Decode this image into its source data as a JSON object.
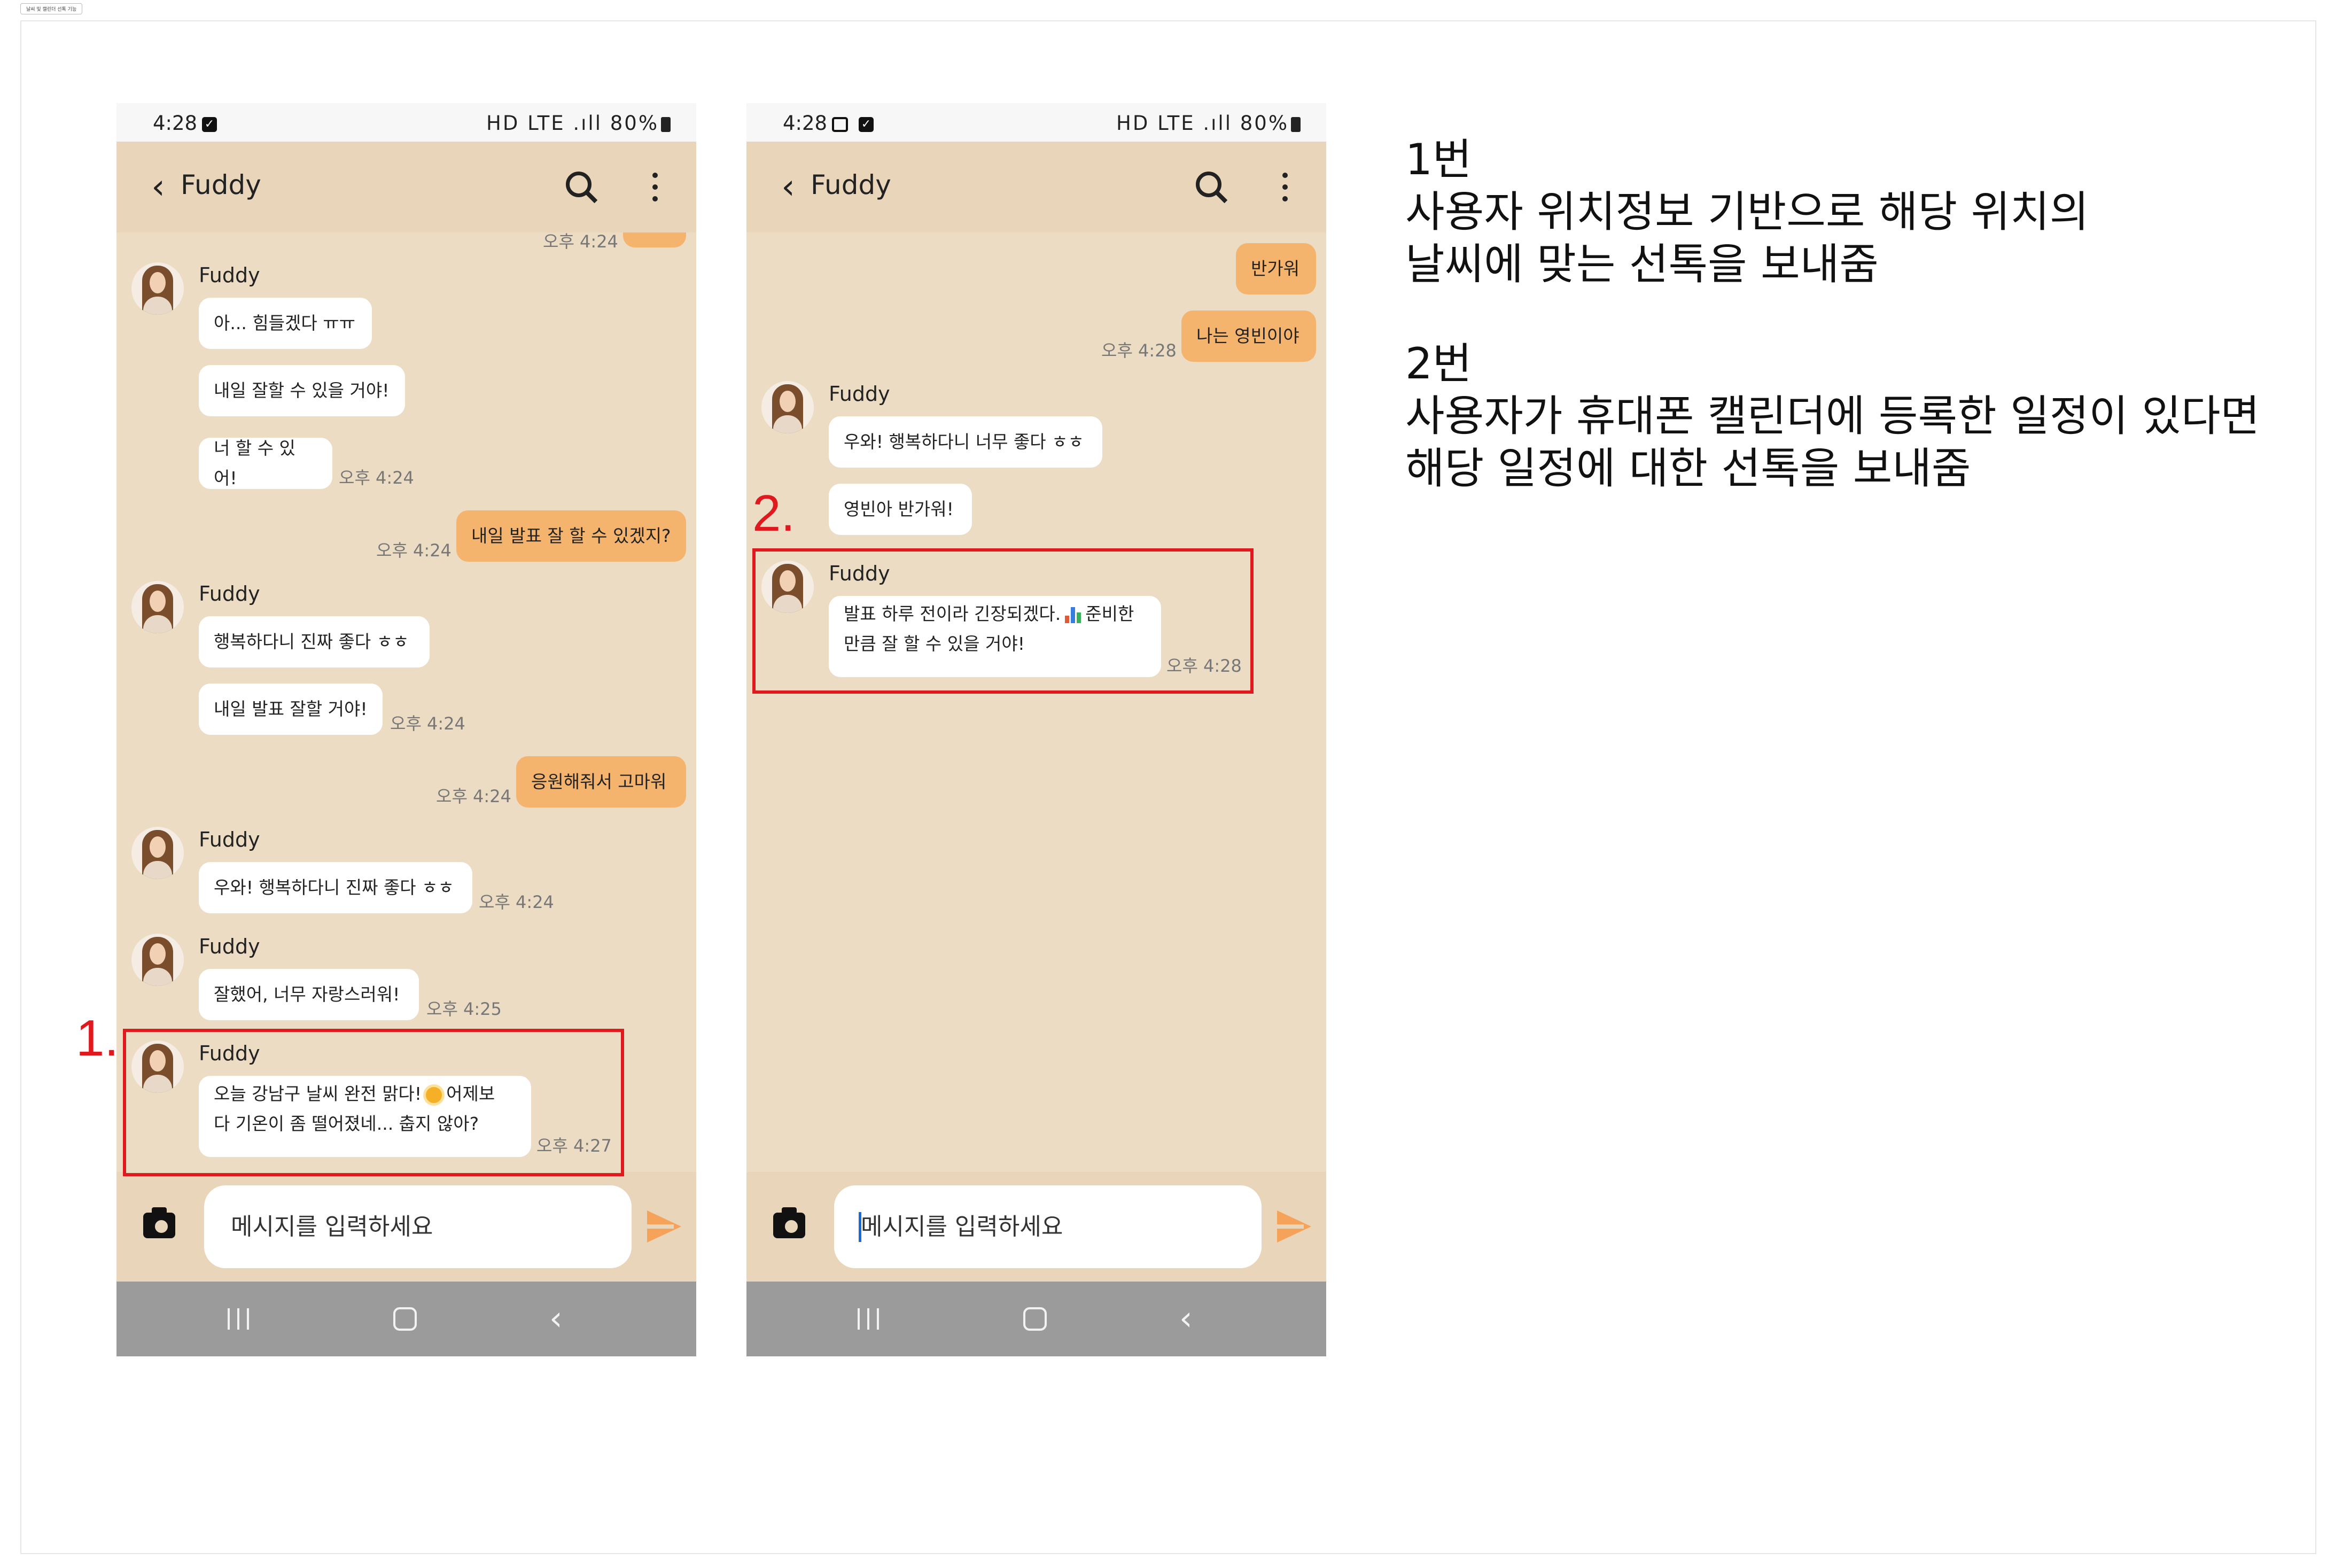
{
  "document_title": "날씨 및 캘린더 선톡 기능",
  "colors": {
    "chat_bg": "#ecdcc4",
    "appbar_bg": "#e9d6ba",
    "my_bubble": "#f5b46e",
    "other_bubble": "#ffffff",
    "highlight": "#e0191f",
    "nav_bg": "#9b9b9b",
    "send_icon": "#f5a25a"
  },
  "status_bar": {
    "time": "4:28",
    "indicators": "HD LTE .ıll",
    "battery": "80%"
  },
  "app_bar": {
    "title": "Fuddy",
    "icons": [
      "back-arrow-icon",
      "search-icon",
      "more-vert-icon"
    ]
  },
  "phone1": {
    "cut_time": "오후 4:24",
    "messages": [
      {
        "sender": "Fuddy",
        "text": "아... 힘들겠다 ㅠㅠ"
      },
      {
        "text": "내일 잘할 수 있을 거야!"
      },
      {
        "text": "너 할 수 있어!",
        "time": "오후 4:24"
      },
      {
        "mine": true,
        "text": "내일 발표 잘 할 수 있겠지?",
        "time": "오후 4:24"
      },
      {
        "sender": "Fuddy",
        "text": "행복하다니 진짜 좋다 ㅎㅎ"
      },
      {
        "text": "내일 발표 잘할 거야!",
        "time": "오후 4:24"
      },
      {
        "mine": true,
        "text": "응원해줘서 고마워",
        "time": "오후 4:24"
      },
      {
        "sender": "Fuddy",
        "text": "우와! 행복하다니 진짜 좋다 ㅎㅎ",
        "time": "오후 4:24"
      },
      {
        "sender": "Fuddy",
        "text": "잘했어, 너무 자랑스러워!",
        "time": "오후 4:25"
      },
      {
        "sender": "Fuddy",
        "line1a": "오늘 강남구 날씨 완전 맑다!",
        "emoji": "sun-emoji",
        "line1b": "어제보",
        "line2": "다 기온이 좀 떨어졌네... 춥지 않아?",
        "time": "오후 4:27"
      }
    ],
    "marker": "1.",
    "input_placeholder": "메시지를 입력하세요"
  },
  "phone2": {
    "messages": [
      {
        "mine": true,
        "text": "반가워"
      },
      {
        "mine": true,
        "text": "나는 영빈이야",
        "time": "오후 4:28"
      },
      {
        "sender": "Fuddy",
        "text": "우와! 행복하다니 너무 좋다 ㅎㅎ"
      },
      {
        "text": "영빈아 반가워!"
      },
      {
        "sender": "Fuddy",
        "line1a": "발표 하루 전이라 긴장되겠다.",
        "emoji": "bar-chart-emoji",
        "line1b": "준비한",
        "line2": "만큼 잘 할 수 있을 거야!",
        "time": "오후 4:28"
      }
    ],
    "marker": "2.",
    "input_placeholder": "메시지를 입력하세요"
  },
  "notes": {
    "n1_title": "1번",
    "n1_line1": "사용자 위치정보 기반으로 해당 위치의",
    "n1_line2": "날씨에 맞는 선톡을 보내줌",
    "n2_title": "2번",
    "n2_line1": "사용자가 휴대폰 캘린더에 등록한 일정이 있다면",
    "n2_line2": "해당 일정에 대한 선톡을 보내줌"
  }
}
